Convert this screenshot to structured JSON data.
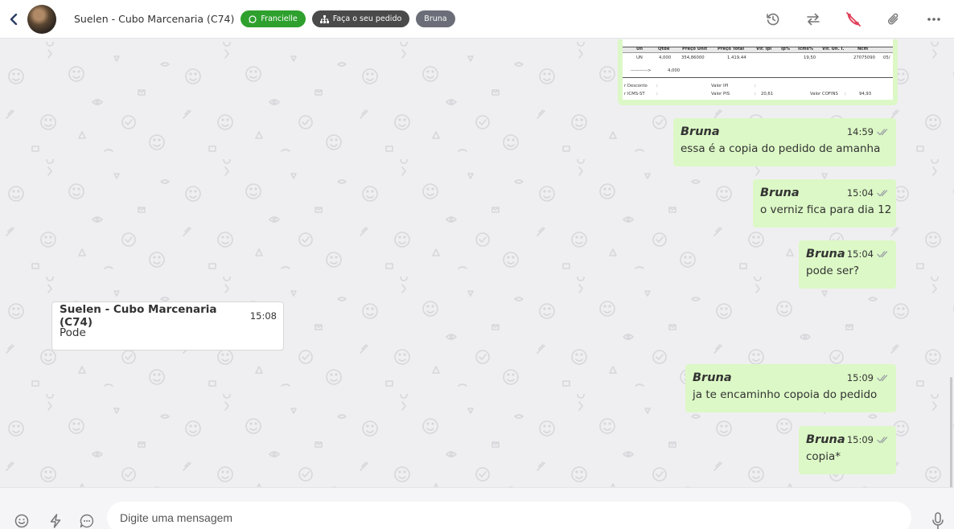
{
  "header": {
    "contact_name": "Suelen - Cubo Marcenaria (C74)",
    "tags": [
      {
        "label": "Francielle",
        "color": "#2ea02e",
        "icon": "whatsapp-icon"
      },
      {
        "label": "Faça o seu pedido",
        "color": "#4a4a4a",
        "icon": "sitemap-icon"
      },
      {
        "label": "Bruna",
        "color": "#6b6e78"
      }
    ],
    "actions": [
      "history-icon",
      "transfer-icon",
      "end-call-icon",
      "attach-icon",
      "more-icon"
    ]
  },
  "image_message": {
    "headers": [
      "Un",
      "Qtde",
      "Preço Unit",
      "Preço Total",
      "Vlr. Ipi",
      "Ip%",
      "Icms%",
      "Vlr. Un. I.",
      "Ncm"
    ],
    "row1": [
      "UN",
      "4,000",
      "354,86000",
      "1.419,44",
      "19,50",
      "27075090",
      "05/"
    ],
    "row2": [
      "----------->",
      "4,000"
    ],
    "footer1": [
      "r Desconto",
      ":",
      "Valor IPI",
      ":"
    ],
    "footer2": [
      "r ICMS-ST",
      ":",
      "Valor PIS",
      ":",
      "20,61",
      "Valor COFINS",
      ":",
      "94,93"
    ]
  },
  "messages": [
    {
      "sender": "Bruna",
      "time": "14:59",
      "text": "essa é a copia do pedido de amanha",
      "outgoing": true
    },
    {
      "sender": "Bruna",
      "time": "15:04",
      "text": "o verniz fica para dia 12",
      "outgoing": true
    },
    {
      "sender": "Bruna",
      "time": "15:04",
      "text": "pode ser?",
      "outgoing": true
    },
    {
      "sender": "Suelen - Cubo Marcenaria (C74)",
      "time": "15:08",
      "text": "Pode",
      "outgoing": false
    },
    {
      "sender": "Bruna",
      "time": "15:09",
      "text": "ja te encaminho copoia do pedido",
      "outgoing": true
    },
    {
      "sender": "Bruna",
      "time": "15:09",
      "text": "copia*",
      "outgoing": true
    }
  ],
  "composer": {
    "placeholder": "Digite uma mensagem",
    "icons": [
      "emoji-icon",
      "quick-reply-icon",
      "message-template-icon",
      "microphone-icon"
    ]
  },
  "colors": {
    "outgoing_bubble": "#dcf8c6",
    "incoming_bubble": "#ffffff",
    "chat_background": "#efeff1",
    "accent_green": "#2ea02e",
    "end_call_red": "#e0405a"
  }
}
